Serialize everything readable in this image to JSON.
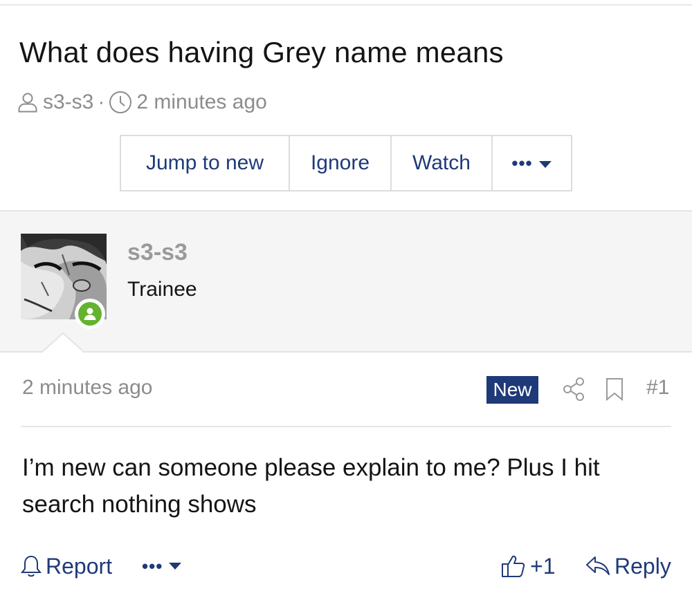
{
  "thread": {
    "title": "What does having Grey name means",
    "author": "s3-s3",
    "separator": "·",
    "time": "2 minutes ago"
  },
  "toolbar": {
    "jump_label": "Jump to new",
    "ignore_label": "Ignore",
    "watch_label": "Watch",
    "more_label": "•••"
  },
  "post": {
    "username": "s3-s3",
    "user_title": "Trainee",
    "time": "2 minutes ago",
    "new_badge": "New",
    "number": "#1",
    "body": "I’m new can someone please explain to me? Plus I hit search nothing shows",
    "actions": {
      "report": "Report",
      "more": "•••",
      "react": "+1",
      "reply": "Reply"
    }
  },
  "colors": {
    "accent": "#1f3a78",
    "muted": "#8c8c8c",
    "online": "#63b32e"
  },
  "icons": [
    "user-icon",
    "clock-icon",
    "caret-down-icon",
    "share-icon",
    "bookmark-icon",
    "bell-icon",
    "thumbs-up-icon",
    "reply-icon"
  ]
}
